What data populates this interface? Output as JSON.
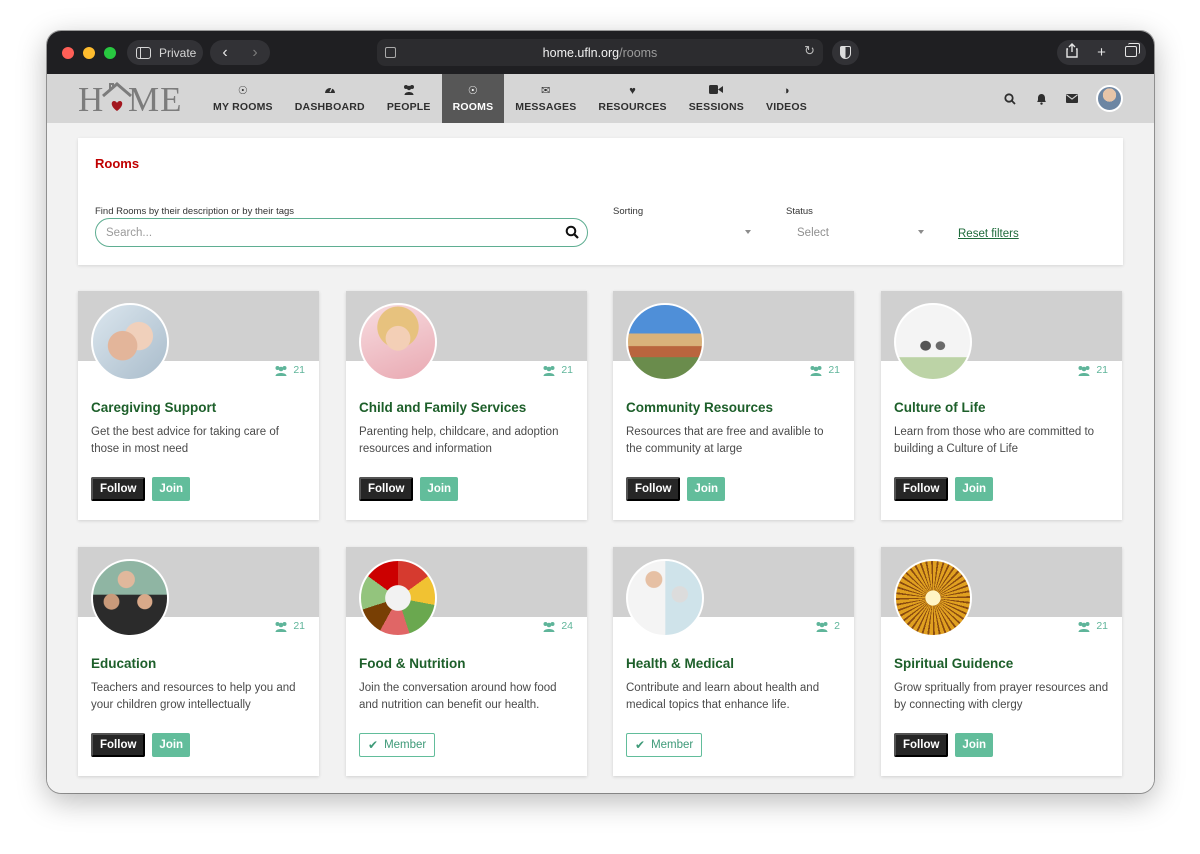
{
  "browser": {
    "private_label": "Private",
    "url_host": "home.ufln.org",
    "url_path": "/rooms"
  },
  "app": {
    "logo_h": "H",
    "logo_me": "ME",
    "nav": [
      {
        "label": "MY ROOMS",
        "icon": "target-icon"
      },
      {
        "label": "DASHBOARD",
        "icon": "dashboard-icon"
      },
      {
        "label": "PEOPLE",
        "icon": "people-icon"
      },
      {
        "label": "ROOMS",
        "icon": "target-icon",
        "active": true
      },
      {
        "label": "MESSAGES",
        "icon": "envelope-icon"
      },
      {
        "label": "RESOURCES",
        "icon": "heart-icon"
      },
      {
        "label": "SESSIONS",
        "icon": "video-camera-icon"
      },
      {
        "label": "VIDEOS",
        "icon": "contrast-icon"
      }
    ]
  },
  "filters": {
    "title": "Rooms",
    "search_label": "Find Rooms by their description or by their tags",
    "search_placeholder": "Search...",
    "sorting_label": "Sorting",
    "sorting_value": "",
    "status_label": "Status",
    "status_value": "Select",
    "reset_label": "Reset filters"
  },
  "rooms": [
    {
      "title": "Caregiving Support",
      "description": "Get the best advice for taking care of those in most need",
      "count": "21",
      "state": "follow",
      "follow_label": "Follow",
      "join_label": "Join"
    },
    {
      "title": "Child and Family Services",
      "description": "Parenting help, childcare, and adoption resources and information",
      "count": "21",
      "state": "follow",
      "follow_label": "Follow",
      "join_label": "Join"
    },
    {
      "title": "Community Resources",
      "description": "Resources that are free and avalible to the community at large",
      "count": "21",
      "state": "follow",
      "follow_label": "Follow",
      "join_label": "Join"
    },
    {
      "title": "Culture of Life",
      "description": "Learn from those who are committed to building a Culture of Life",
      "count": "21",
      "state": "follow",
      "follow_label": "Follow",
      "join_label": "Join"
    },
    {
      "title": "Education",
      "description": "Teachers and resources to help you and your children grow intellectually",
      "count": "21",
      "state": "follow",
      "follow_label": "Follow",
      "join_label": "Join"
    },
    {
      "title": "Food & Nutrition",
      "description": "Join the conversation around how food and nutrition can benefit our health.",
      "count": "24",
      "state": "member",
      "member_label": "Member"
    },
    {
      "title": "Health & Medical",
      "description": "Contribute and learn about health and medical topics that enhance life.",
      "count": "2",
      "state": "member",
      "member_label": "Member"
    },
    {
      "title": "Spiritual Guidence",
      "description": "Grow spritually from prayer resources and by connecting with clergy",
      "count": "21",
      "state": "follow",
      "follow_label": "Follow",
      "join_label": "Join"
    }
  ],
  "colors": {
    "accent_green": "#62bd9b",
    "title_green": "#1d5f2a",
    "rooms_red": "#c00000",
    "nav_active": "#575757"
  }
}
